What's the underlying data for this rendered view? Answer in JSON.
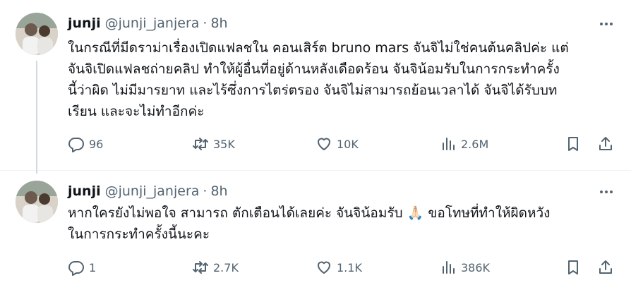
{
  "tweets": [
    {
      "author_name": "junji",
      "handle": "@junji_janjera",
      "separator": "·",
      "time": "8h",
      "text": "ในกรณีที่มีดราม่าเรื่องเปิดแฟลชใน คอนเสิร์ต bruno mars จันจิไม่ใช่คนต้นคลิปค่ะ แต่\nจันจิเปิดแฟลชถ่ายคลิป ทำให้ผู้อื่นที่อยู่ด้านหลังเดือดร้อน จันจิน้อมรับในการกระทำครั้ง\nนี้ว่าผิด ไม่มีมารยาท และไร้ซึ่งการไตร่ตรอง จันจิไม่สามารถย้อนเวลาได้ จันจิได้รับบท\nเรียน และจะไม่ทำอีกค่ะ",
      "replies": "96",
      "reposts": "35K",
      "likes": "10K",
      "views": "2.6M"
    },
    {
      "author_name": "junji",
      "handle": "@junji_janjera",
      "separator": "·",
      "time": "8h",
      "text": "หากใครยังไม่พอใจ สามารถ ตักเตือนได้เลยค่ะ จันจิน้อมรับ 🙏🏻 ขอโทษที่ทำให้ผิดหวัง\nในการกระทำครั้งนี้นะคะ",
      "replies": "1",
      "reposts": "2.7K",
      "likes": "1.1K",
      "views": "386K"
    }
  ],
  "icons": {
    "reply": "reply-icon",
    "repost": "repost-icon",
    "like": "heart-icon",
    "views": "views-icon",
    "bookmark": "bookmark-icon",
    "share": "share-icon",
    "more": "more-icon"
  },
  "colors": {
    "text_primary": "#0f1419",
    "text_secondary": "#536471",
    "thread_line": "#cfd9de",
    "divider": "#eff3f4"
  }
}
